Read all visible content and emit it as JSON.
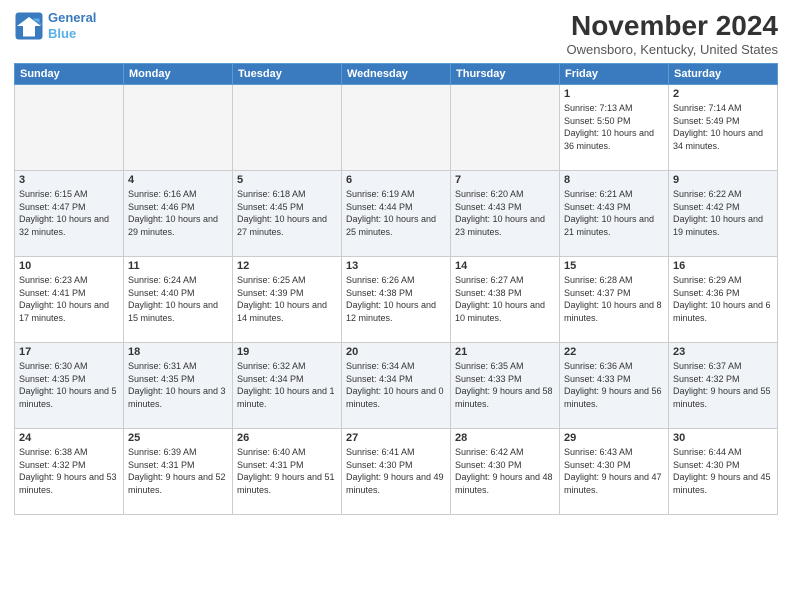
{
  "header": {
    "logo_line1": "General",
    "logo_line2": "Blue",
    "month": "November 2024",
    "location": "Owensboro, Kentucky, United States"
  },
  "days_of_week": [
    "Sunday",
    "Monday",
    "Tuesday",
    "Wednesday",
    "Thursday",
    "Friday",
    "Saturday"
  ],
  "weeks": [
    {
      "days": [
        {
          "num": "",
          "info": ""
        },
        {
          "num": "",
          "info": ""
        },
        {
          "num": "",
          "info": ""
        },
        {
          "num": "",
          "info": ""
        },
        {
          "num": "",
          "info": ""
        },
        {
          "num": "1",
          "info": "Sunrise: 7:13 AM\nSunset: 5:50 PM\nDaylight: 10 hours and 36 minutes."
        },
        {
          "num": "2",
          "info": "Sunrise: 7:14 AM\nSunset: 5:49 PM\nDaylight: 10 hours and 34 minutes."
        }
      ]
    },
    {
      "days": [
        {
          "num": "3",
          "info": "Sunrise: 6:15 AM\nSunset: 4:47 PM\nDaylight: 10 hours and 32 minutes."
        },
        {
          "num": "4",
          "info": "Sunrise: 6:16 AM\nSunset: 4:46 PM\nDaylight: 10 hours and 29 minutes."
        },
        {
          "num": "5",
          "info": "Sunrise: 6:18 AM\nSunset: 4:45 PM\nDaylight: 10 hours and 27 minutes."
        },
        {
          "num": "6",
          "info": "Sunrise: 6:19 AM\nSunset: 4:44 PM\nDaylight: 10 hours and 25 minutes."
        },
        {
          "num": "7",
          "info": "Sunrise: 6:20 AM\nSunset: 4:43 PM\nDaylight: 10 hours and 23 minutes."
        },
        {
          "num": "8",
          "info": "Sunrise: 6:21 AM\nSunset: 4:43 PM\nDaylight: 10 hours and 21 minutes."
        },
        {
          "num": "9",
          "info": "Sunrise: 6:22 AM\nSunset: 4:42 PM\nDaylight: 10 hours and 19 minutes."
        }
      ]
    },
    {
      "days": [
        {
          "num": "10",
          "info": "Sunrise: 6:23 AM\nSunset: 4:41 PM\nDaylight: 10 hours and 17 minutes."
        },
        {
          "num": "11",
          "info": "Sunrise: 6:24 AM\nSunset: 4:40 PM\nDaylight: 10 hours and 15 minutes."
        },
        {
          "num": "12",
          "info": "Sunrise: 6:25 AM\nSunset: 4:39 PM\nDaylight: 10 hours and 14 minutes."
        },
        {
          "num": "13",
          "info": "Sunrise: 6:26 AM\nSunset: 4:38 PM\nDaylight: 10 hours and 12 minutes."
        },
        {
          "num": "14",
          "info": "Sunrise: 6:27 AM\nSunset: 4:38 PM\nDaylight: 10 hours and 10 minutes."
        },
        {
          "num": "15",
          "info": "Sunrise: 6:28 AM\nSunset: 4:37 PM\nDaylight: 10 hours and 8 minutes."
        },
        {
          "num": "16",
          "info": "Sunrise: 6:29 AM\nSunset: 4:36 PM\nDaylight: 10 hours and 6 minutes."
        }
      ]
    },
    {
      "days": [
        {
          "num": "17",
          "info": "Sunrise: 6:30 AM\nSunset: 4:35 PM\nDaylight: 10 hours and 5 minutes."
        },
        {
          "num": "18",
          "info": "Sunrise: 6:31 AM\nSunset: 4:35 PM\nDaylight: 10 hours and 3 minutes."
        },
        {
          "num": "19",
          "info": "Sunrise: 6:32 AM\nSunset: 4:34 PM\nDaylight: 10 hours and 1 minute."
        },
        {
          "num": "20",
          "info": "Sunrise: 6:34 AM\nSunset: 4:34 PM\nDaylight: 10 hours and 0 minutes."
        },
        {
          "num": "21",
          "info": "Sunrise: 6:35 AM\nSunset: 4:33 PM\nDaylight: 9 hours and 58 minutes."
        },
        {
          "num": "22",
          "info": "Sunrise: 6:36 AM\nSunset: 4:33 PM\nDaylight: 9 hours and 56 minutes."
        },
        {
          "num": "23",
          "info": "Sunrise: 6:37 AM\nSunset: 4:32 PM\nDaylight: 9 hours and 55 minutes."
        }
      ]
    },
    {
      "days": [
        {
          "num": "24",
          "info": "Sunrise: 6:38 AM\nSunset: 4:32 PM\nDaylight: 9 hours and 53 minutes."
        },
        {
          "num": "25",
          "info": "Sunrise: 6:39 AM\nSunset: 4:31 PM\nDaylight: 9 hours and 52 minutes."
        },
        {
          "num": "26",
          "info": "Sunrise: 6:40 AM\nSunset: 4:31 PM\nDaylight: 9 hours and 51 minutes."
        },
        {
          "num": "27",
          "info": "Sunrise: 6:41 AM\nSunset: 4:30 PM\nDaylight: 9 hours and 49 minutes."
        },
        {
          "num": "28",
          "info": "Sunrise: 6:42 AM\nSunset: 4:30 PM\nDaylight: 9 hours and 48 minutes."
        },
        {
          "num": "29",
          "info": "Sunrise: 6:43 AM\nSunset: 4:30 PM\nDaylight: 9 hours and 47 minutes."
        },
        {
          "num": "30",
          "info": "Sunrise: 6:44 AM\nSunset: 4:30 PM\nDaylight: 9 hours and 45 minutes."
        }
      ]
    }
  ]
}
